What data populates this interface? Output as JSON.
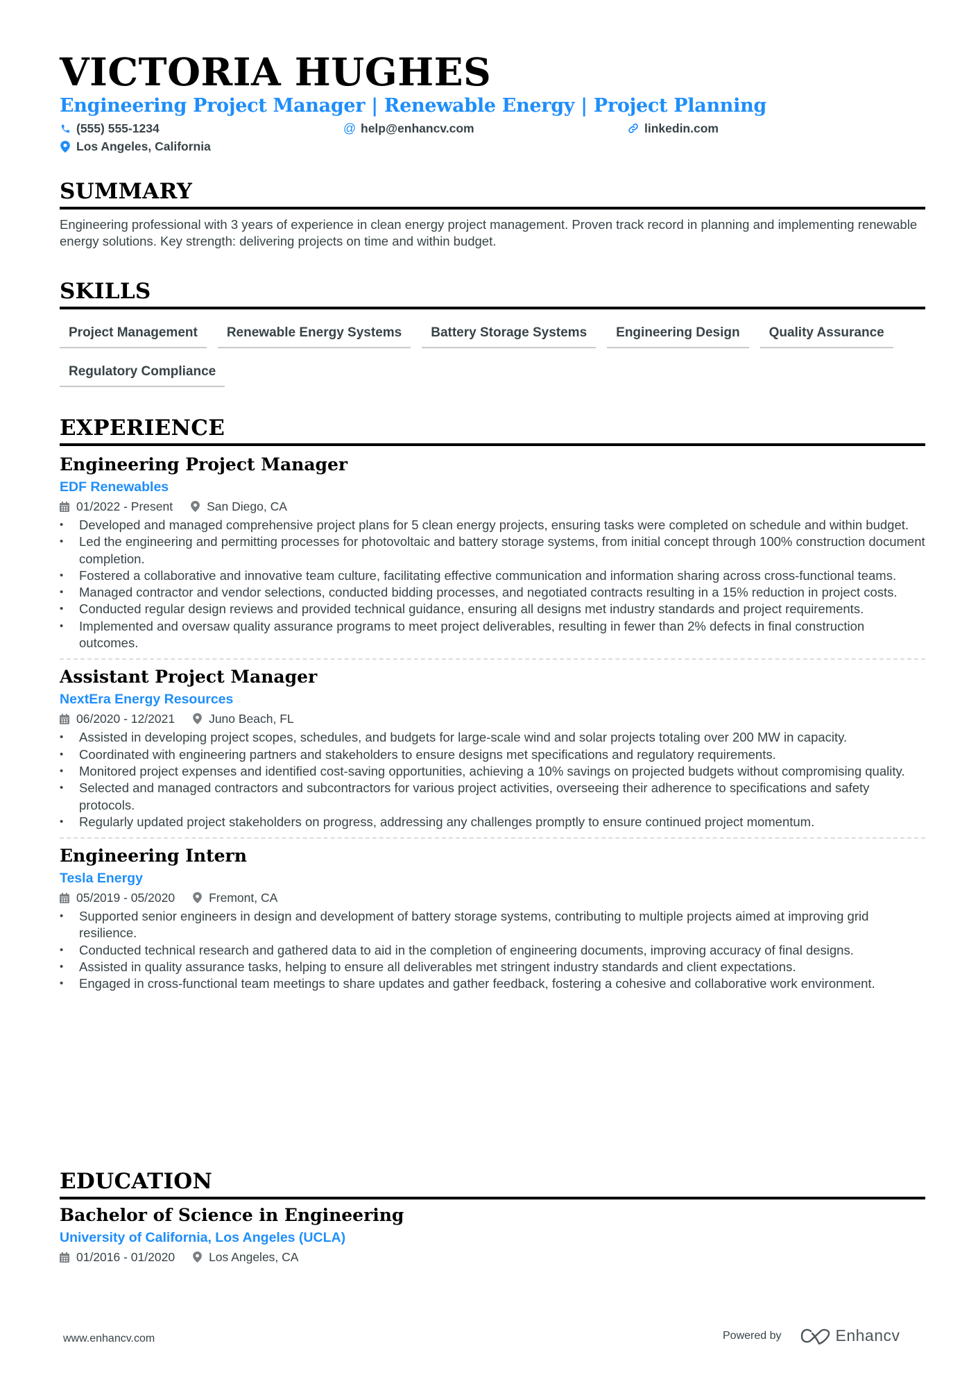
{
  "header": {
    "name": "VICTORIA HUGHES",
    "headline": "Engineering Project Manager | Renewable Energy | Project Planning",
    "contacts": {
      "phone": "(555) 555-1234",
      "email": "help@enhancv.com",
      "linkedin": "linkedin.com",
      "location": "Los Angeles, California"
    },
    "icons": {
      "phone": "phone-icon",
      "email": "at-sign-icon",
      "linkedin": "link-icon",
      "location": "map-pin-icon"
    }
  },
  "colors": {
    "accent": "#1f8efa",
    "text": "#384347",
    "heading": "#000000"
  },
  "summary": {
    "title": "SUMMARY",
    "text": "Engineering professional with 3 years of experience in clean energy project management. Proven track record in planning and implementing renewable energy solutions. Key strength: delivering projects on time and within budget."
  },
  "skills": {
    "title": "SKILLS",
    "items": [
      "Project Management",
      "Renewable Energy Systems",
      "Battery Storage Systems",
      "Engineering Design",
      "Quality Assurance",
      "Regulatory Compliance"
    ]
  },
  "experience": {
    "title": "EXPERIENCE",
    "jobs": [
      {
        "role": "Engineering Project Manager",
        "company": "EDF Renewables",
        "dates": "01/2022 - Present",
        "location": "San Diego, CA",
        "bullets": [
          "Developed and managed comprehensive project plans for 5 clean energy projects, ensuring tasks were completed on schedule and within budget.",
          "Led the engineering and permitting processes for photovoltaic and battery storage systems, from initial concept through 100% construction document completion.",
          "Fostered a collaborative and innovative team culture, facilitating effective communication and information sharing across cross-functional teams.",
          "Managed contractor and vendor selections, conducted bidding processes, and negotiated contracts resulting in a 15% reduction in project costs.",
          "Conducted regular design reviews and provided technical guidance, ensuring all designs met industry standards and project requirements.",
          "Implemented and oversaw quality assurance programs to meet project deliverables, resulting in fewer than 2% defects in final construction outcomes."
        ]
      },
      {
        "role": "Assistant Project Manager",
        "company": "NextEra Energy Resources",
        "dates": "06/2020 - 12/2021",
        "location": "Juno Beach, FL",
        "bullets": [
          "Assisted in developing project scopes, schedules, and budgets for large-scale wind and solar projects totaling over 200 MW in capacity.",
          "Coordinated with engineering partners and stakeholders to ensure designs met specifications and regulatory requirements.",
          "Monitored project expenses and identified cost-saving opportunities, achieving a 10% savings on projected budgets without compromising quality.",
          "Selected and managed contractors and subcontractors for various project activities, overseeing their adherence to specifications and safety protocols.",
          "Regularly updated project stakeholders on progress, addressing any challenges promptly to ensure continued project momentum."
        ]
      },
      {
        "role": "Engineering Intern",
        "company": "Tesla Energy",
        "dates": "05/2019 - 05/2020",
        "location": "Fremont, CA",
        "bullets": [
          "Supported senior engineers in design and development of battery storage systems, contributing to multiple projects aimed at improving grid resilience.",
          "Conducted technical research and gathered data to aid in the completion of engineering documents, improving accuracy of final designs.",
          "Assisted in quality assurance tasks, helping to ensure all deliverables met stringent industry standards and client expectations.",
          "Engaged in cross-functional team meetings to share updates and gather feedback, fostering a cohesive and collaborative work environment."
        ]
      }
    ]
  },
  "education": {
    "title": "EDUCATION",
    "items": [
      {
        "degree": "Bachelor of Science in Engineering",
        "school": "University of California, Los Angeles (UCLA)",
        "dates": "01/2016 - 01/2020",
        "location": "Los Angeles, CA"
      }
    ]
  },
  "footer": {
    "website": "www.enhancv.com",
    "powered_by": "Powered by",
    "brand": "Enhancv"
  }
}
